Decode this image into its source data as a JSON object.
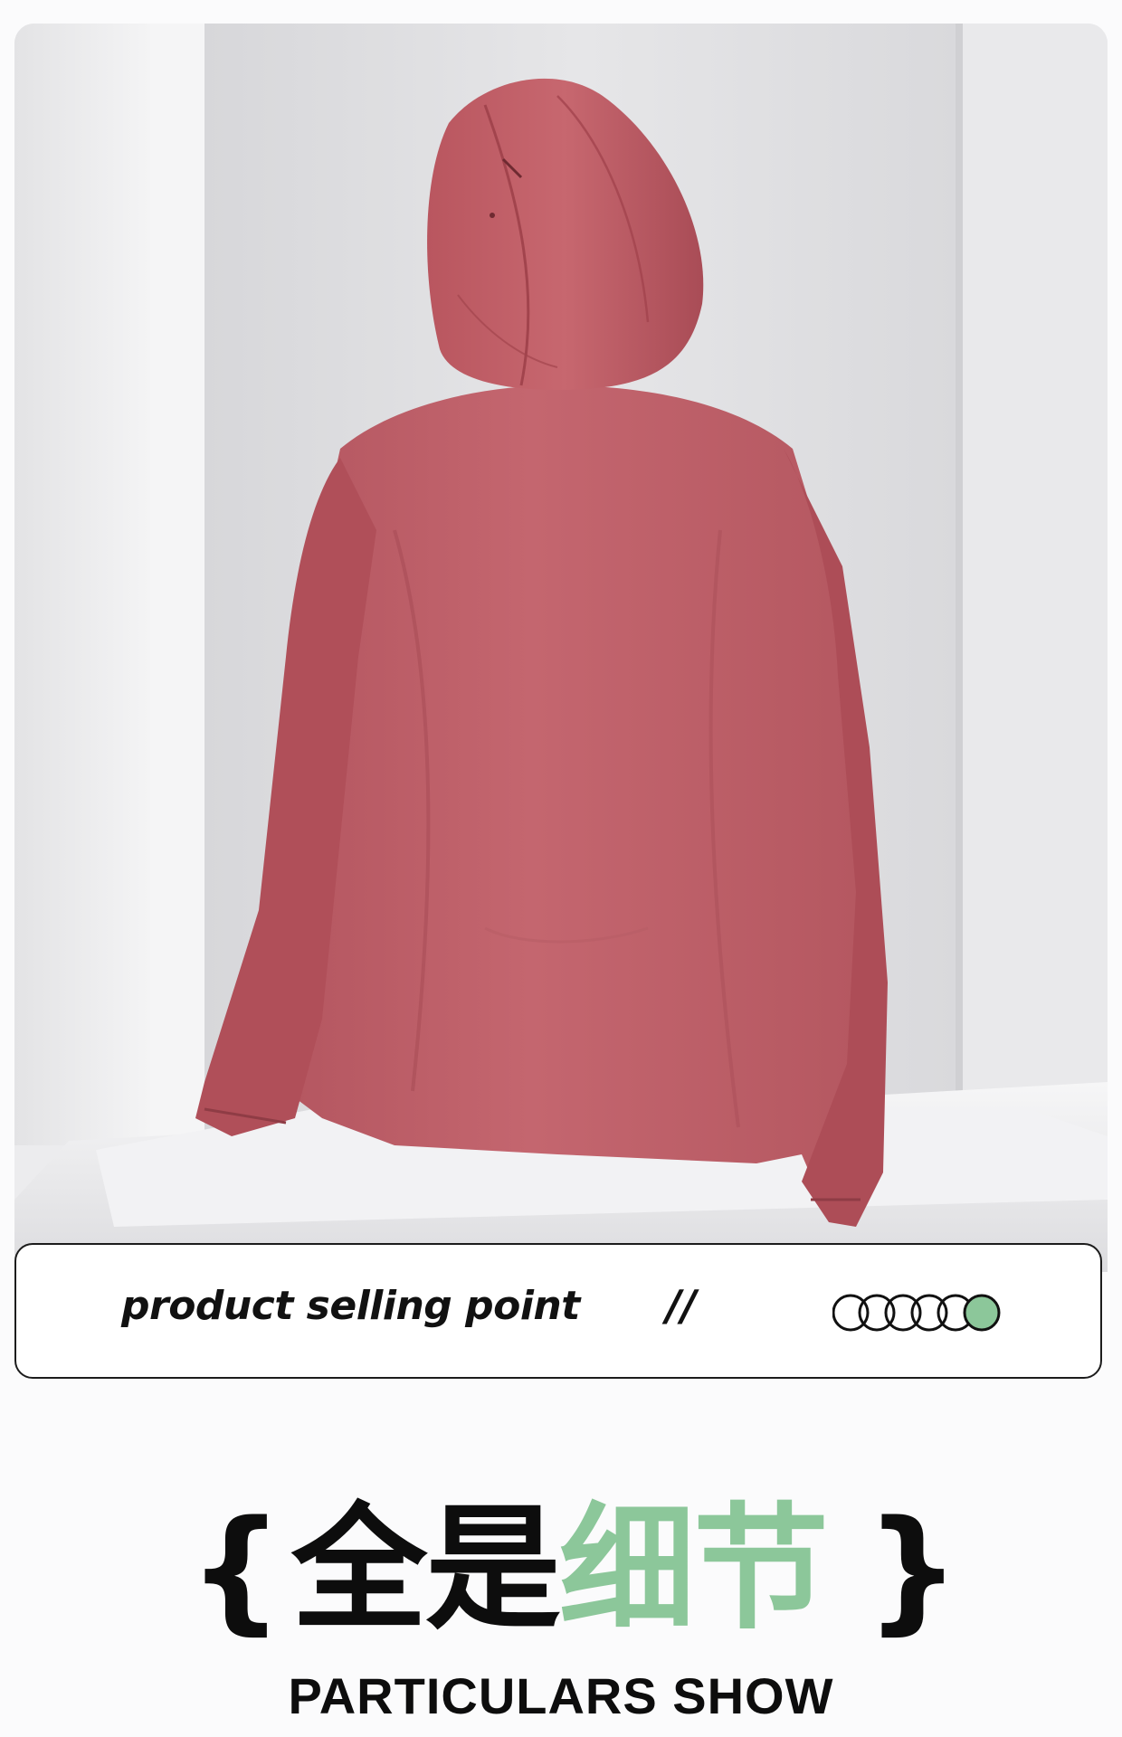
{
  "selling_point": {
    "label": "product selling point",
    "divider": "//",
    "rings": {
      "total": 6,
      "active_index": 6,
      "active_color": "#8cc79a"
    }
  },
  "section": {
    "brace_left": "{",
    "brace_right": "}",
    "title_dark": "全是",
    "title_green": "细节",
    "subtitle": "PARTICULARS SHOW"
  },
  "colors": {
    "jacket": "#c0606a",
    "accent_green": "#8cc79a",
    "ink": "#0d0d0d"
  }
}
